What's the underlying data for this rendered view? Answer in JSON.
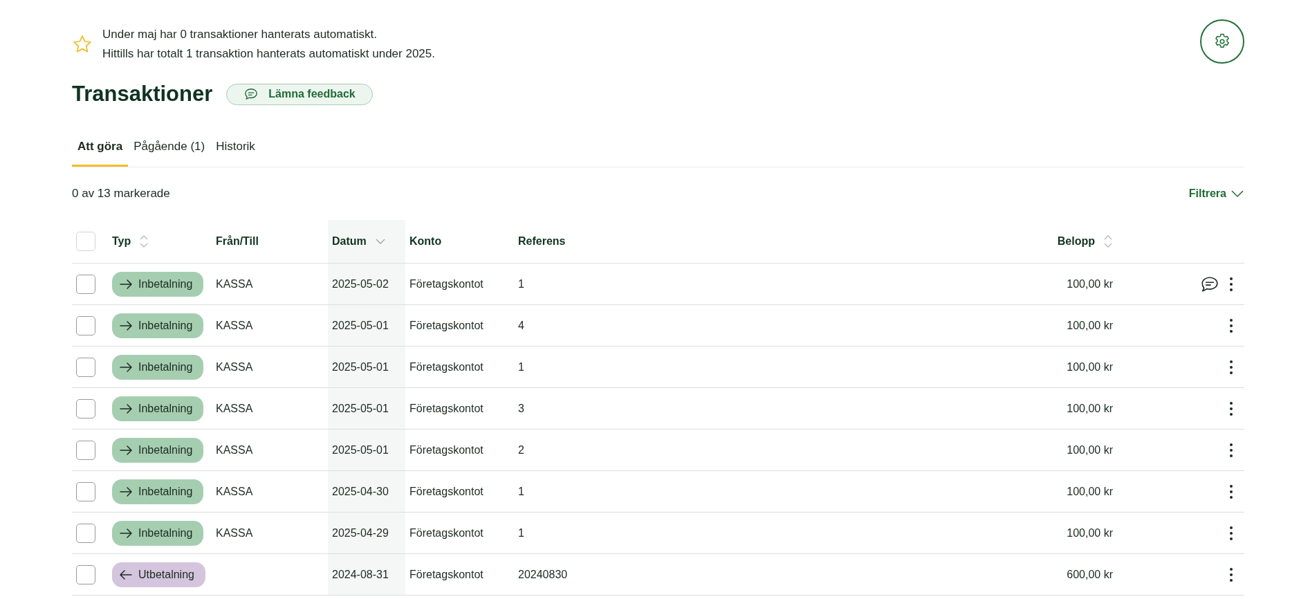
{
  "notice": {
    "lines": [
      "Under maj har 0 transaktioner hanterats automatiskt.",
      "Hittills har totalt 1 transaktion hanterats automatiskt under 2025."
    ]
  },
  "title": "Transaktioner",
  "feedback_button": "Lämna feedback",
  "tabs": [
    {
      "label": "Att göra",
      "selected": true
    },
    {
      "label": "Pågående (1)",
      "selected": false
    },
    {
      "label": "Historik",
      "selected": false
    }
  ],
  "selection_count": "0 av 13 markerade",
  "filter_button": "Filtrera",
  "table": {
    "select_all_checked": false,
    "columns": [
      {
        "label": "Typ",
        "sortable": true,
        "sorted": false
      },
      {
        "label": "Från/Till",
        "sortable": false,
        "sorted": false
      },
      {
        "label": "Datum",
        "sortable": true,
        "sorted": true
      },
      {
        "label": "Konto",
        "sortable": false,
        "sorted": false
      },
      {
        "label": "Referens",
        "sortable": false,
        "sorted": false
      },
      {
        "label": "Belopp",
        "sortable": true,
        "sorted": false
      }
    ],
    "rows": [
      {
        "checked": false,
        "kind": "in",
        "type": "Inbetalning",
        "party": "KASSA",
        "date": "2025-05-02",
        "account": "Företagskontot",
        "reference": "1",
        "amount": "100,00 kr",
        "has_comment": true
      },
      {
        "checked": false,
        "kind": "in",
        "type": "Inbetalning",
        "party": "KASSA",
        "date": "2025-05-01",
        "account": "Företagskontot",
        "reference": "4",
        "amount": "100,00 kr",
        "has_comment": false
      },
      {
        "checked": false,
        "kind": "in",
        "type": "Inbetalning",
        "party": "KASSA",
        "date": "2025-05-01",
        "account": "Företagskontot",
        "reference": "1",
        "amount": "100,00 kr",
        "has_comment": false
      },
      {
        "checked": false,
        "kind": "in",
        "type": "Inbetalning",
        "party": "KASSA",
        "date": "2025-05-01",
        "account": "Företagskontot",
        "reference": "3",
        "amount": "100,00 kr",
        "has_comment": false
      },
      {
        "checked": false,
        "kind": "in",
        "type": "Inbetalning",
        "party": "KASSA",
        "date": "2025-05-01",
        "account": "Företagskontot",
        "reference": "2",
        "amount": "100,00 kr",
        "has_comment": false
      },
      {
        "checked": false,
        "kind": "in",
        "type": "Inbetalning",
        "party": "KASSA",
        "date": "2025-04-30",
        "account": "Företagskontot",
        "reference": "1",
        "amount": "100,00 kr",
        "has_comment": false
      },
      {
        "checked": false,
        "kind": "in",
        "type": "Inbetalning",
        "party": "KASSA",
        "date": "2025-04-29",
        "account": "Företagskontot",
        "reference": "1",
        "amount": "100,00 kr",
        "has_comment": false
      },
      {
        "checked": false,
        "kind": "out",
        "type": "Utbetalning",
        "date": "2024-08-31",
        "account": "Företagskontot",
        "reference": "20240830",
        "amount": "600,00 kr",
        "has_comment": false
      }
    ]
  }
}
